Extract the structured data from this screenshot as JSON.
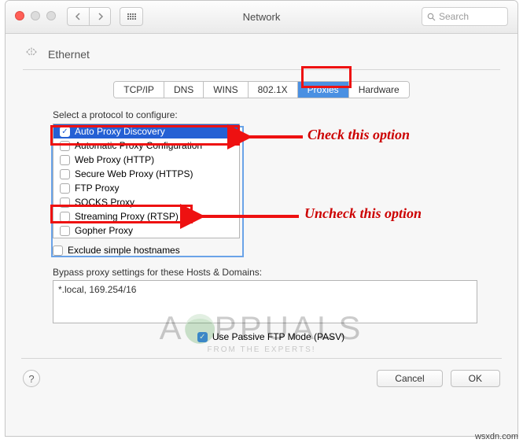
{
  "window": {
    "title": "Network",
    "search_placeholder": "Search"
  },
  "header": {
    "interface": "Ethernet"
  },
  "tabs": [
    "TCP/IP",
    "DNS",
    "WINS",
    "802.1X",
    "Proxies",
    "Hardware"
  ],
  "tabs_active_index": 4,
  "prompt": "Select a protocol to configure:",
  "protocols": [
    {
      "label": "Auto Proxy Discovery",
      "checked": true,
      "selected": true
    },
    {
      "label": "Automatic Proxy Configuration",
      "checked": false,
      "selected": false
    },
    {
      "label": "Web Proxy (HTTP)",
      "checked": false,
      "selected": false
    },
    {
      "label": "Secure Web Proxy (HTTPS)",
      "checked": false,
      "selected": false
    },
    {
      "label": "FTP Proxy",
      "checked": false,
      "selected": false
    },
    {
      "label": "SOCKS Proxy",
      "checked": false,
      "selected": false
    },
    {
      "label": "Streaming Proxy (RTSP)",
      "checked": false,
      "selected": false
    },
    {
      "label": "Gopher Proxy",
      "checked": false,
      "selected": false
    }
  ],
  "exclude_label": "Exclude simple hostnames",
  "exclude_checked": false,
  "bypass_label": "Bypass proxy settings for these Hosts & Domains:",
  "bypass_value": "*.local, 169.254/16",
  "pasv_label": "Use Passive FTP Mode (PASV)",
  "pasv_checked": true,
  "buttons": {
    "help": "?",
    "cancel": "Cancel",
    "ok": "OK"
  },
  "annotations": {
    "check": "Check this option",
    "uncheck": "Uncheck this option"
  },
  "watermark": {
    "big_left": "A",
    "big_right": "PPUALS",
    "small": "FROM THE EXPERTS!"
  },
  "credit": "wsxdn.com"
}
